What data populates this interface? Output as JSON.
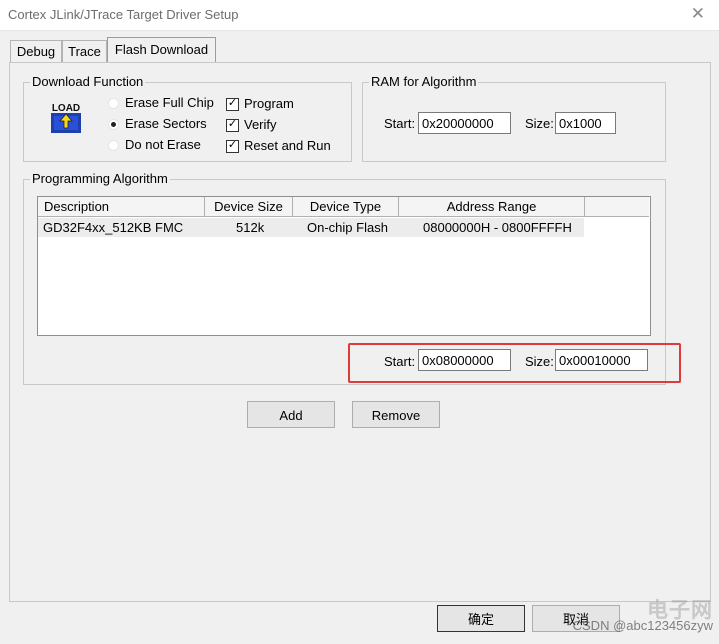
{
  "window": {
    "title": "Cortex JLink/JTrace Target Driver Setup",
    "close_glyph": "✕"
  },
  "tabs": [
    {
      "label": "Debug"
    },
    {
      "label": "Trace"
    },
    {
      "label": "Flash Download",
      "active": true
    }
  ],
  "download_function": {
    "title": "Download Function",
    "icon": "load-icon",
    "icon_text": "LOAD",
    "radios": [
      {
        "label": "Erase Full Chip",
        "checked": false
      },
      {
        "label": "Erase Sectors",
        "checked": true
      },
      {
        "label": "Do not Erase",
        "checked": false
      }
    ],
    "checks": [
      {
        "label": "Program",
        "checked": true
      },
      {
        "label": "Verify",
        "checked": true
      },
      {
        "label": "Reset and Run",
        "checked": true
      }
    ]
  },
  "ram": {
    "title": "RAM for Algorithm",
    "start_label": "Start:",
    "start_value": "0x20000000",
    "size_label": "Size:",
    "size_value": "0x1000"
  },
  "algorithm": {
    "title": "Programming Algorithm",
    "columns": [
      "Description",
      "Device Size",
      "Device Type",
      "Address Range"
    ],
    "rows": [
      [
        "GD32F4xx_512KB FMC",
        "512k",
        "On-chip Flash",
        "08000000H - 0800FFFFH"
      ]
    ],
    "start_label": "Start:",
    "start_value": "0x08000000",
    "size_label": "Size:",
    "size_value": "0x00010000"
  },
  "buttons": {
    "add": "Add",
    "remove": "Remove",
    "ok": "确定",
    "cancel": "取消"
  },
  "watermark": {
    "text": "CSDN @abc123456zyw",
    "logo_text": "电子网"
  },
  "colors": {
    "highlight": "#e03a3a"
  }
}
